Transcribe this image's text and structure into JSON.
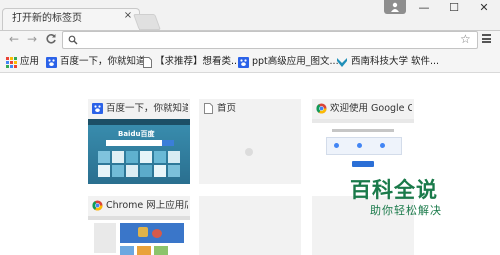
{
  "tab": {
    "title": "打开新的标签页",
    "close": "×"
  },
  "window": {
    "minimize": "—",
    "maximize": "☐",
    "close": "✕"
  },
  "nav": {
    "back": "←",
    "forward": "→",
    "reload": "C"
  },
  "omnibox": {
    "value": "",
    "placeholder": ""
  },
  "bookmarks": [
    {
      "label": "应用"
    },
    {
      "label": "百度一下，你就知道"
    },
    {
      "label": "【求推荐】想看类..."
    },
    {
      "label": "ppt高级应用_图文..."
    },
    {
      "label": "西南科技大学 软件..."
    }
  ],
  "tiles": [
    {
      "title": "百度一下，你就知道",
      "thumb_text": "Baidu百度"
    },
    {
      "title": "首页"
    },
    {
      "title": "欢迎使用 Google Chrome"
    },
    {
      "title": "Chrome 网上应用店"
    },
    {
      "title": ""
    },
    {
      "title": ""
    }
  ],
  "watermark": {
    "title": "百科全说",
    "subtitle": "助你轻松解决"
  },
  "colors": {
    "watermark": "#1a7a4a",
    "baidu_blue": "#2b62e8",
    "chrome_blue": "#2b6fd6"
  }
}
